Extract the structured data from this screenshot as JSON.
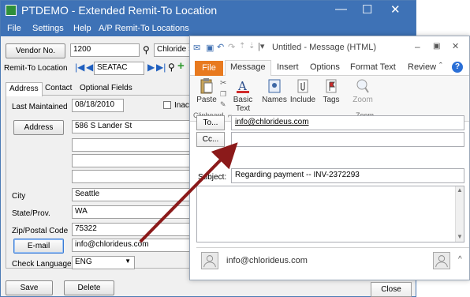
{
  "sage": {
    "title": "PTDEMO - Extended Remit-To Location",
    "menu": [
      "File",
      "Settings",
      "Help",
      "A/P Remit-To Locations"
    ],
    "vendor_button": "Vendor No.",
    "vendor_no": "1200",
    "vendor_name": "Chloride Sys",
    "remit_to_label": "Remit-To Location",
    "remit_to_code": "SEATAC",
    "tabs": [
      "Address",
      "Contact",
      "Optional Fields"
    ],
    "last_maintained_label": "Last Maintained",
    "last_maintained": "08/18/2010",
    "inactive_label": "Inacti",
    "address_button": "Address",
    "address_line1": "586 S Lander St",
    "city_label": "City",
    "city": "Seattle",
    "state_label": "State/Prov.",
    "state": "WA",
    "zip_label": "Zip/Postal Code",
    "zip": "75322",
    "email_button": "E-mail",
    "email": "info@chlorideus.com",
    "check_language_label": "Check Language",
    "check_language": "ENG",
    "save_button": "Save",
    "delete_button": "Delete"
  },
  "outlook": {
    "title": "Untitled - Message (HTML)",
    "ribbon_tabs": [
      "File",
      "Message",
      "Insert",
      "Options",
      "Format Text",
      "Review"
    ],
    "ribbon_buttons": {
      "paste": "Paste",
      "basic_text": "Basic Text",
      "names": "Names",
      "include": "Include",
      "tags": "Tags",
      "zoom": "Zoom"
    },
    "groups": {
      "clipboard": "Clipboard",
      "zoom": "Zoom"
    },
    "to_button": "To...",
    "to_value": "info@chlorideus.com",
    "cc_button": "Cc...",
    "subject_label": "Subject:",
    "subject_value": "Regarding payment -- INV-2372293",
    "people_email": "info@chlorideus.com",
    "close_button": "Close"
  },
  "colors": {
    "sage_titlebar": "#3e72b6",
    "outlook_file_tab": "#e87a1f",
    "arrow": "#8b1a1a"
  }
}
